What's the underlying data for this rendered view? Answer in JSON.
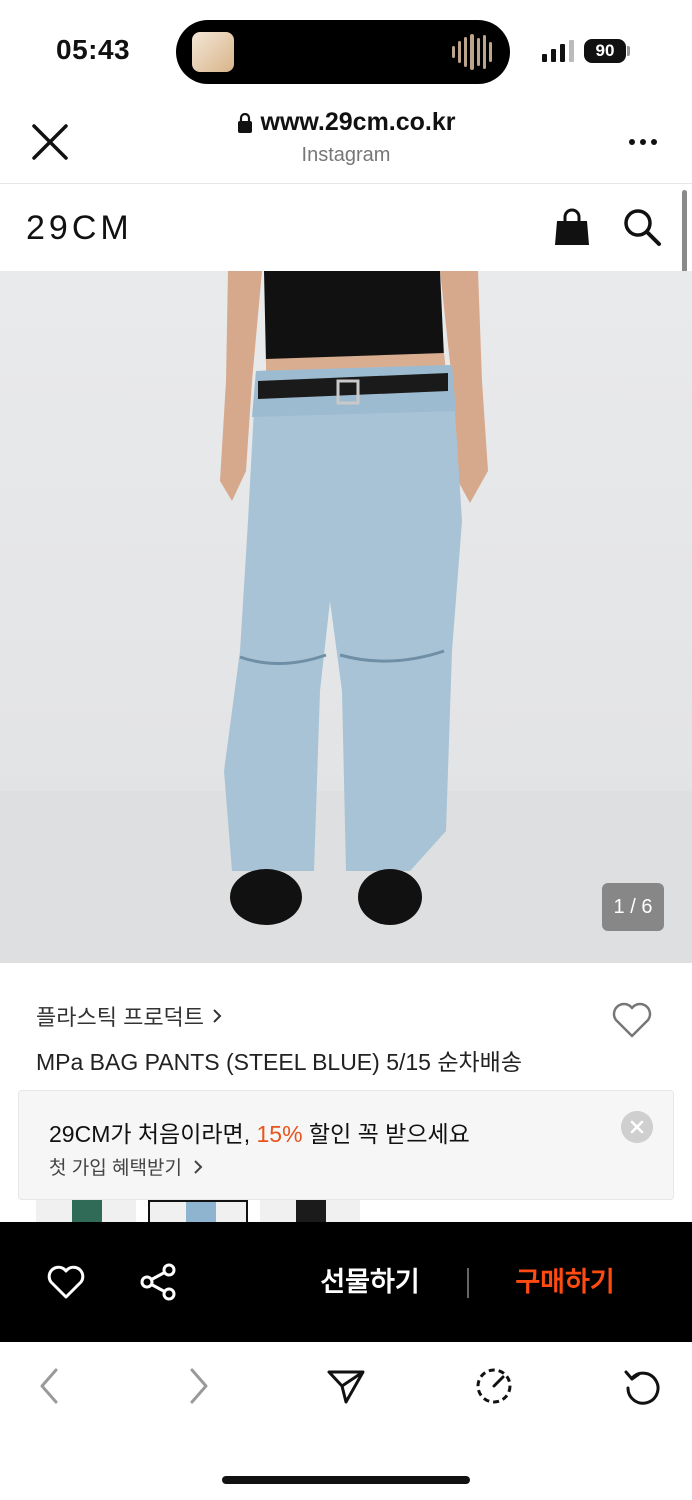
{
  "status_bar": {
    "time": "05:43",
    "battery": "90"
  },
  "browser": {
    "url": "www.29cm.co.kr",
    "subtitle": "Instagram"
  },
  "site": {
    "logo": "29CM"
  },
  "product": {
    "image_counter": "1 / 6",
    "brand": "플라스틱 프로덕트",
    "title": "MPa BAG PANTS (STEEL BLUE) 5/15 순차배송"
  },
  "promo": {
    "title_pre": "29CM가 처음이라면, ",
    "title_highlight": "15%",
    "title_post": " 할인 꼭 받으세요",
    "subtitle": "첫 가입 혜택받기"
  },
  "action_bar": {
    "gift_label": "선물하기",
    "buy_label": "구매하기"
  },
  "colors": {
    "accent": "#ff4b12",
    "promo_highlight": "#e8541d",
    "action_bar_bg": "#000000"
  }
}
